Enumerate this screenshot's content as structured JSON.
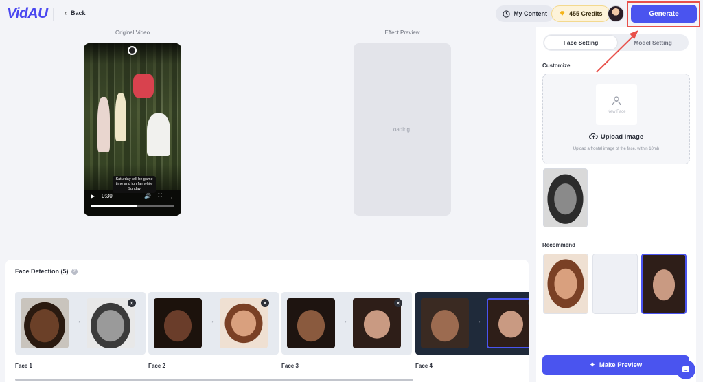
{
  "header": {
    "logo": "VidAU",
    "back_label": "Back",
    "my_content_label": "My Content",
    "credits_label": "455 Credits",
    "generate_label": "Generate"
  },
  "video": {
    "original_label": "Original Video",
    "effect_label": "Effect Preview",
    "caption": "Saturday will be game time and fun fair while Sunday",
    "time": "0:30",
    "progress": 0.56,
    "effect_status": "Loading..."
  },
  "face_detection": {
    "title": "Face Detection (5)",
    "faces": [
      {
        "label": "Face 1"
      },
      {
        "label": "Face 2"
      },
      {
        "label": "Face 3"
      },
      {
        "label": "Face 4"
      }
    ]
  },
  "panel": {
    "tabs": [
      "Face Setting",
      "Model Setting"
    ],
    "customize_label": "Customize",
    "new_face_label": "New Face",
    "upload_title": "Upload Image",
    "upload_sub": "Upload a frontal image of the face, within 10mb",
    "recommend_label": "Recommend",
    "make_preview_label": "Make Preview"
  },
  "colors": {
    "accent": "#4a54ef",
    "highlight": "#e8504a"
  }
}
